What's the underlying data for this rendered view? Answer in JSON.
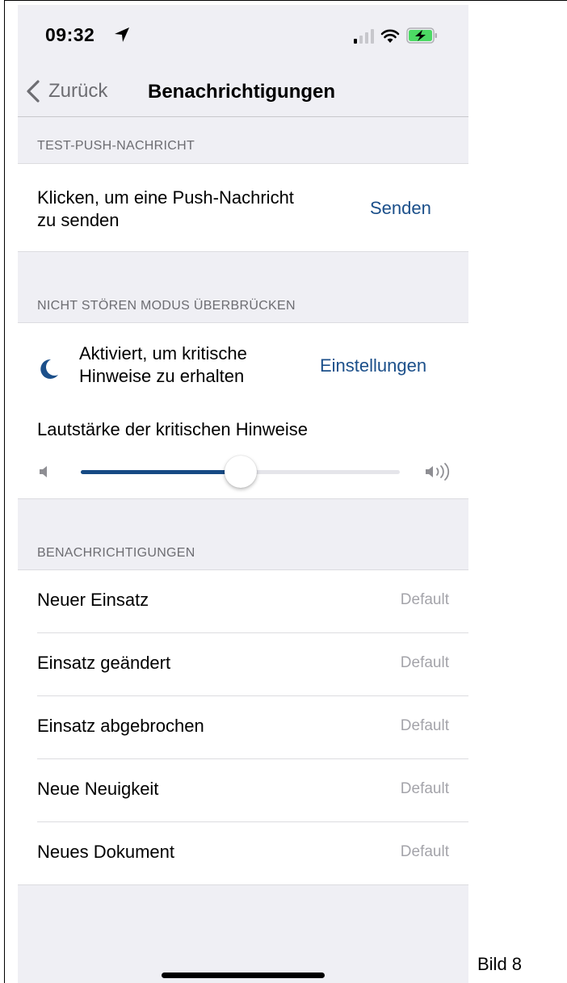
{
  "status_bar": {
    "time": "09:32",
    "icons": [
      "location-arrow-icon",
      "signal-icon",
      "wifi-icon",
      "battery-charging-icon"
    ]
  },
  "nav": {
    "back_label": "Zurück",
    "title": "Benachrichtigungen"
  },
  "sections": {
    "test_push": {
      "header": "TEST-PUSH-NACHRICHT",
      "text_line1": "Klicken, um eine Push-Nachricht",
      "text_line2": "zu senden",
      "action": "Senden"
    },
    "dnd": {
      "header": "NICHT STÖREN MODUS ÜBERBRÜCKEN",
      "text_line1": "Aktiviert, um kritische",
      "text_line2": "Hinweise zu erhalten",
      "action": "Einstellungen",
      "volume_label": "Lautstärke der kritischen Hinweise",
      "volume_level": 0.5
    },
    "notifications": {
      "header": "BENACHRICHTIGUNGEN",
      "items": [
        {
          "label": "Neuer Einsatz",
          "value": "Default"
        },
        {
          "label": "Einsatz geändert",
          "value": "Default"
        },
        {
          "label": "Einsatz abgebrochen",
          "value": "Default"
        },
        {
          "label": "Neue Neuigkeit",
          "value": "Default"
        },
        {
          "label": "Neues Dokument",
          "value": "Default"
        }
      ]
    }
  },
  "caption": "Bild 8",
  "colors": {
    "accent": "#1b4f8a",
    "slider_fill": "#164a84",
    "background": "#efeff4",
    "secondary_text": "#6d6d72",
    "value_text": "#a4a4aa"
  }
}
